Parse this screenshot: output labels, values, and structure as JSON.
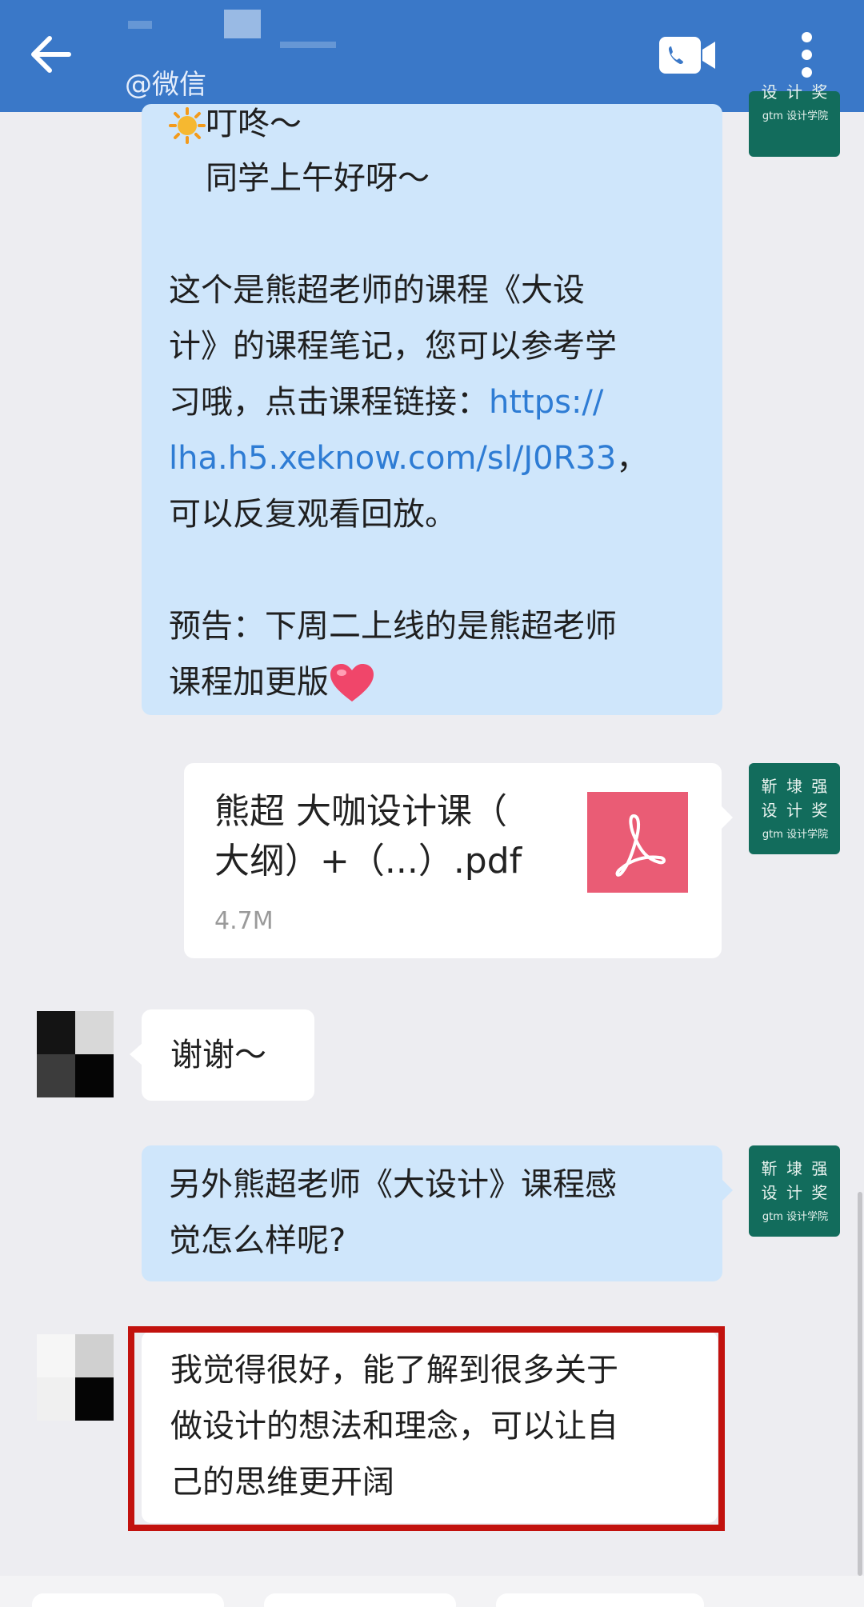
{
  "header": {
    "subtitle": "@微信",
    "back_icon": "arrow-left-icon",
    "call_icon": "phone-video-icon",
    "more_icon": "more-vertical-icon",
    "bg_color": "#3a78c8"
  },
  "brand_avatar": {
    "chars": [
      "靳",
      "埭",
      "强",
      "设",
      "计",
      "奖"
    ],
    "sub": "gtm 设计学院"
  },
  "messages": {
    "m1": {
      "line1": "叮咚～",
      "line2": "同学上午好呀～",
      "p2_l1": "这个是熊超老师的课程《大设",
      "p2_l2": "计》的课程笔记，您可以参考学",
      "p2_l3_pre": "习哦，点击课程链接：",
      "p2_l3_link": "https://",
      "p2_l4_link": "lha.h5.xeknow.com/sl/J0R33",
      "p2_l4_post": "，",
      "p2_l5": "可以反复观看回放。",
      "p3_l1": "预告：下周二上线的是熊超老师",
      "p3_l2": "课程加更版"
    },
    "file": {
      "name_l1": "熊超 大咖设计课（",
      "name_l2": "大纲）+（...）.pdf",
      "size": "4.7M",
      "icon": "pdf-icon"
    },
    "m3": {
      "text": "谢谢～"
    },
    "m4": {
      "l1": "另外熊超老师《大设计》课程感",
      "l2": "觉怎么样呢?"
    },
    "m5": {
      "l1": "我觉得很好，能了解到很多关于",
      "l2": "做设计的想法和理念，可以让自",
      "l3": "己的思维更开阔"
    }
  },
  "colors": {
    "bubble_blue": "#cfe6fb",
    "highlight_red": "#c2120e",
    "link": "#2e7cd4"
  }
}
